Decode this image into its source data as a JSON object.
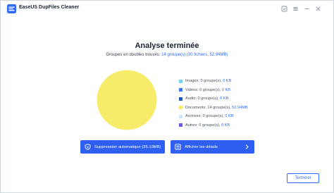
{
  "window": {
    "title": "EaseUS DupFiles Cleaner"
  },
  "heading": "Analyse terminée",
  "summary": {
    "prefix": "Groupes en doubles trouvés:",
    "groups": "14 groupe(s)",
    "detail": "(30 fichiers, 52.94MB)"
  },
  "legend": [
    {
      "label": "Images:",
      "groups": "0 groupe(s),",
      "size": "0 KB",
      "color": "#7fd3f0"
    },
    {
      "label": "Vidéos:",
      "groups": "0 groupe(s),",
      "size": "0 KB",
      "color": "#3d78f0"
    },
    {
      "label": "Audio:",
      "groups": "0 groupe(s),",
      "size": "0 KB",
      "color": "#2657b8"
    },
    {
      "label": "Documents:",
      "groups": "14 groupe(s),",
      "size": "52.94MB",
      "color": "#f7ec6a"
    },
    {
      "label": "Archives:",
      "groups": "0 groupe(s),",
      "size": "0 KB",
      "color": "#cfe6f7"
    },
    {
      "label": "Autres:",
      "groups": "0 groupe(s),",
      "size": "0 KB",
      "color": "#6b5ce6"
    }
  ],
  "pie": {
    "slices": [
      {
        "category": "Documents",
        "value": 52.94,
        "color": "#f7ec6a"
      }
    ]
  },
  "buttons": {
    "auto_remove": "Suppression automatique (35.10MB)",
    "show_details": "Afficher les détails",
    "finish": "Terminer"
  },
  "icons": {
    "app": "easeus-logo-icon",
    "feedback": "feedback-icon",
    "menu": "menu-icon",
    "minimize": "minimize-icon",
    "close": "close-icon",
    "auto_remove": "shield-broom-icon",
    "details": "list-icon",
    "chevron": "chevron-right-icon"
  },
  "colors": {
    "accent": "#2f6bff",
    "primary_button": "#2f5ff0"
  }
}
